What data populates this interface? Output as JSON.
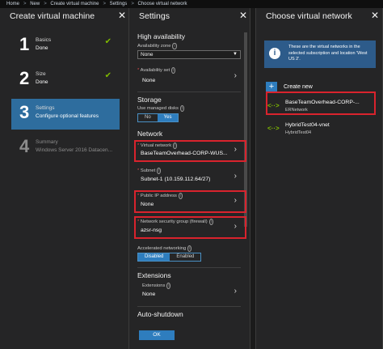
{
  "breadcrumb": [
    "Home",
    "New",
    "Create virtual machine",
    "Settings",
    "Choose virtual network"
  ],
  "blade1": {
    "title": "Create virtual machine",
    "steps": [
      {
        "num": "1",
        "title": "Basics",
        "status": "Done"
      },
      {
        "num": "2",
        "title": "Size",
        "status": "Done"
      },
      {
        "num": "3",
        "title": "Settings",
        "status": "Configure optional features"
      },
      {
        "num": "4",
        "title": "Summary",
        "status": "Windows Server 2016 Datacen..."
      }
    ]
  },
  "blade2": {
    "title": "Settings",
    "high_availability": "High availability",
    "availability_zone_label": "Availability zone",
    "availability_zone_value": "None",
    "availability_set_label": "Availability set",
    "availability_set_value": "None",
    "storage": "Storage",
    "managed_disks_label": "Use managed disks",
    "toggle_no": "No",
    "toggle_yes": "Yes",
    "network": "Network",
    "vnet_label": "Virtual network",
    "vnet_value": "BaseTeamOverhead-CORP-WUS...",
    "subnet_label": "Subnet",
    "subnet_value": "Subnet-1 (10.159.112.64/27)",
    "pip_label": "Public IP address",
    "pip_value": "None",
    "nsg_label": "Network security group (firewall)",
    "nsg_value": "azsr-nsg",
    "accel_label": "Accelerated networking",
    "toggle_disabled": "Disabled",
    "toggle_enabled": "Enabled",
    "extensions": "Extensions",
    "extensions_label": "Extensions",
    "extensions_value": "None",
    "autoshutdown": "Auto-shutdown",
    "ok_label": "OK"
  },
  "blade3": {
    "title": "Choose virtual network",
    "info_text": "These are the virtual networks in the selected subscription and location 'West US 2'.",
    "create_new": "Create new",
    "networks": [
      {
        "name": "BaseTeamOverhead-CORP-...",
        "sub": "ERNetwork"
      },
      {
        "name": "HybridTest04-vnet",
        "sub": "HybridTest04"
      }
    ]
  }
}
